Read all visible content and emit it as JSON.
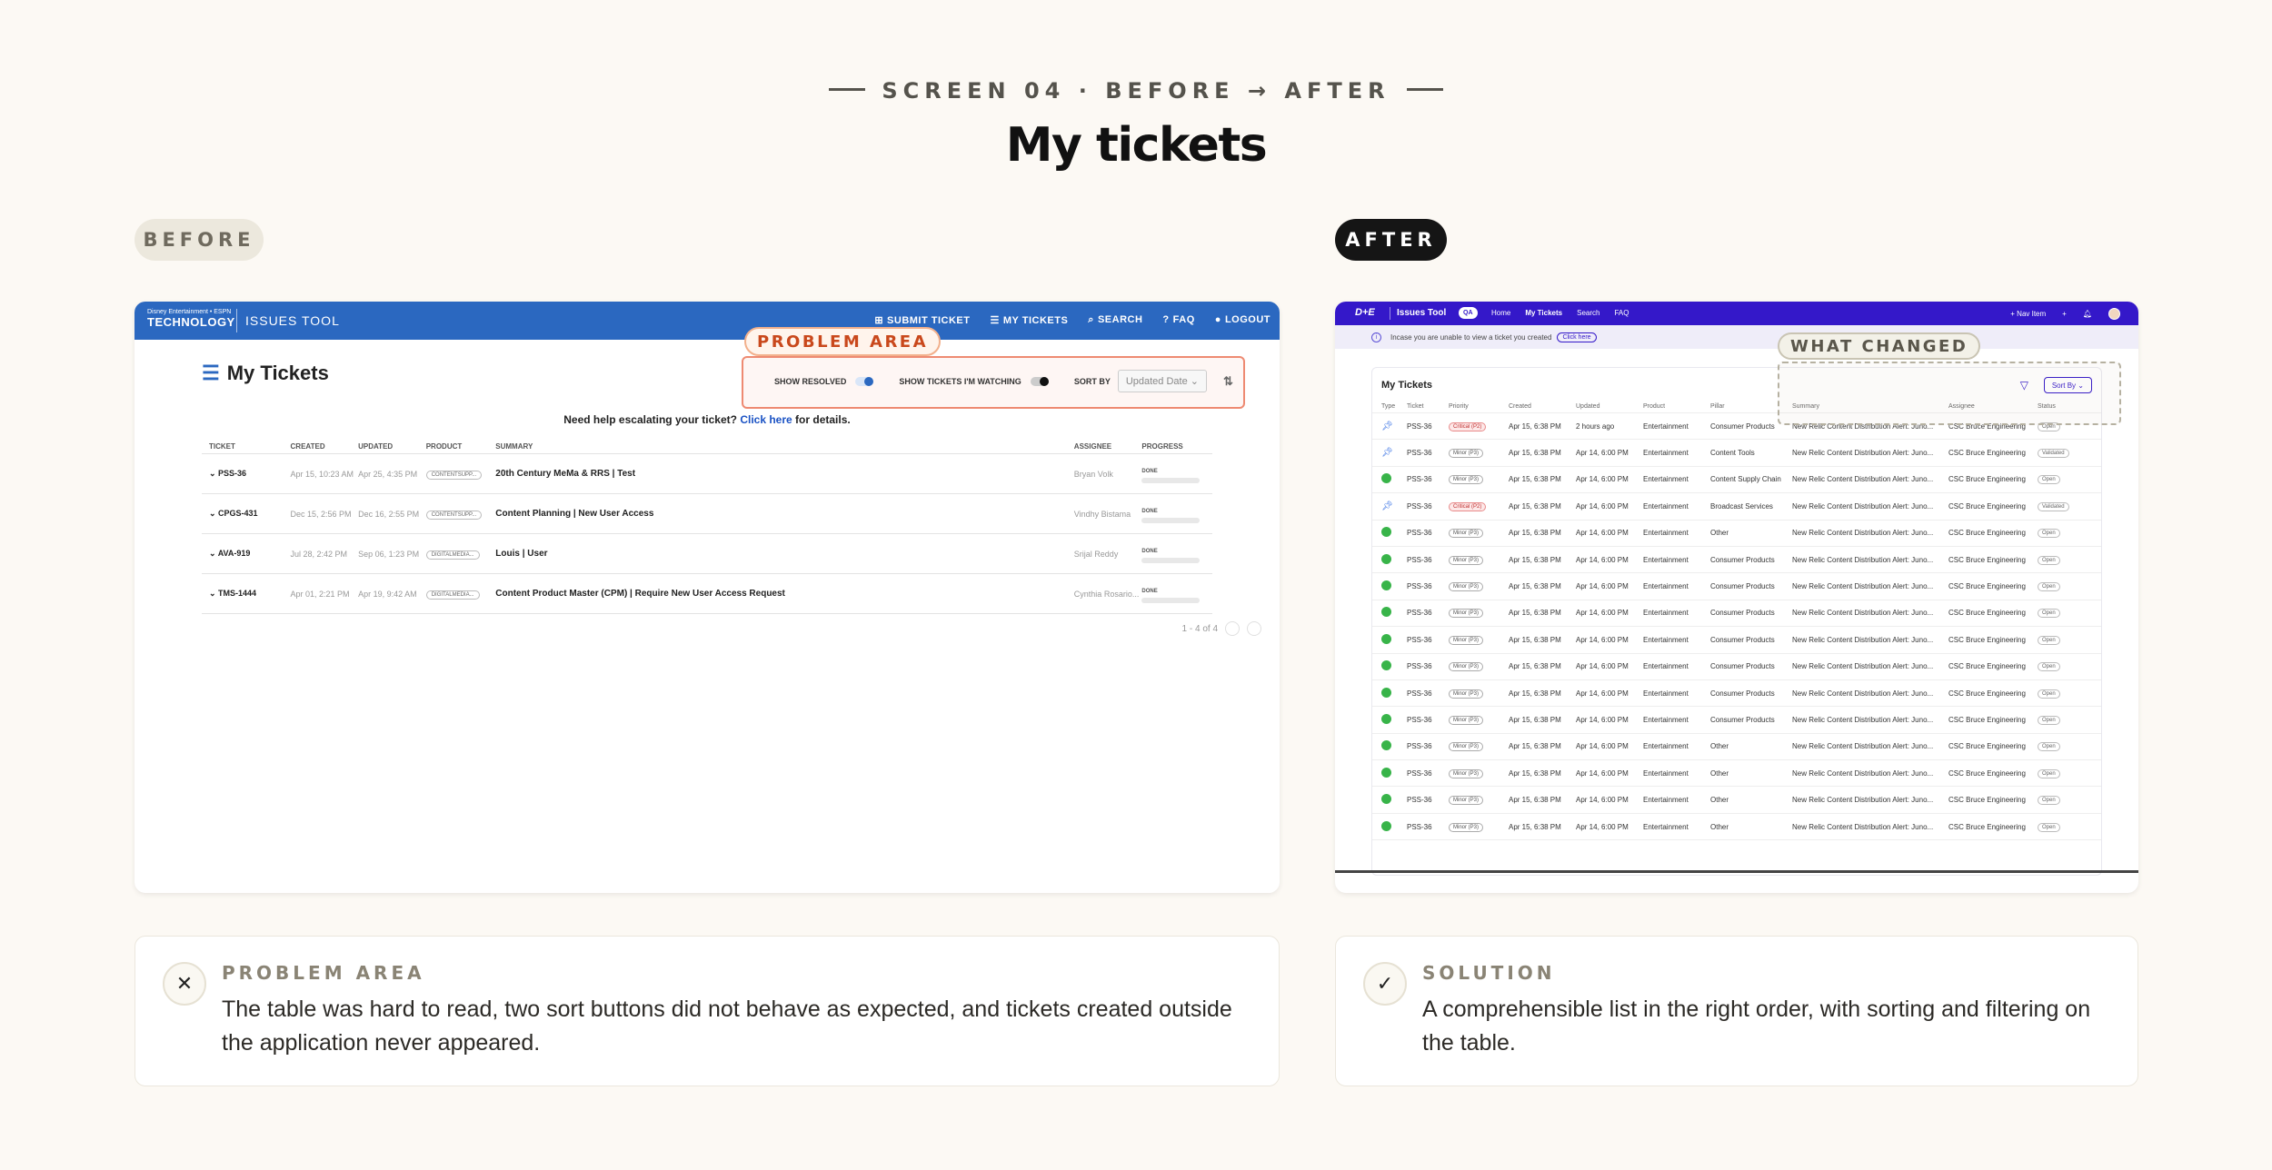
{
  "eyebrow": "SCREEN 04 · BEFORE → AFTER",
  "headline": "My tickets",
  "before_label": "BEFORE",
  "after_label": "AFTER",
  "before_screen": {
    "brand_line1": "Disney Entertainment • ESPN",
    "brand_line2": "TECHNOLOGY",
    "app_name": "ISSUES TOOL",
    "nav": [
      "SUBMIT TICKET",
      "MY TICKETS",
      "SEARCH",
      "FAQ",
      "LOGOUT"
    ],
    "title": "My Tickets",
    "problem_label": "PROBLEM AREA",
    "show_resolved": "SHOW RESOLVED",
    "show_watching": "SHOW TICKETS I'M WATCHING",
    "sort_by": "SORT BY",
    "sort_value": "Updated Date",
    "help_prefix": "Need help escalating your ticket?",
    "help_link": "Click here",
    "help_suffix": "for details.",
    "columns": [
      "TICKET",
      "CREATED",
      "UPDATED",
      "PRODUCT",
      "SUMMARY",
      "ASSIGNEE",
      "PROGRESS"
    ],
    "rows": [
      {
        "ticket": "PSS-36",
        "created": "Apr 15, 10:23 AM",
        "updated": "Apr 25, 4:35 PM",
        "product": "CONTENTSUPP...",
        "summary": "20th Century MeMa & RRS | Test",
        "assignee": "Bryan Volk",
        "progress": "DONE"
      },
      {
        "ticket": "CPGS-431",
        "created": "Dec 15, 2:56 PM",
        "updated": "Dec 16, 2:55 PM",
        "product": "CONTENTSUPP...",
        "summary": "Content Planning | New User Access",
        "assignee": "Vindhy Bistama",
        "progress": "DONE"
      },
      {
        "ticket": "AVA-919",
        "created": "Jul 28, 2:42 PM",
        "updated": "Sep 06, 1:23 PM",
        "product": "DIGITALMEDIA...",
        "summary": "Louis | User",
        "assignee": "Srijal Reddy",
        "progress": "DONE"
      },
      {
        "ticket": "TMS-1444",
        "created": "Apr 01, 2:21 PM",
        "updated": "Apr 19, 9:42 AM",
        "product": "DIGITALMEDIA...",
        "summary": "Content Product Master (CPM) | Require New User Access Request",
        "assignee": "Cynthia Rosario...",
        "progress": "DONE"
      }
    ],
    "pager": "1 - 4 of 4"
  },
  "after_screen": {
    "brand": "D+E",
    "app_name": "Issues Tool",
    "env_badge": "QA",
    "nav": [
      "Home",
      "My Tickets",
      "Search",
      "FAQ"
    ],
    "new_item": "+ Nav Item",
    "banner_text": "Incase you are unable to view a ticket you created",
    "banner_button": "Click here",
    "what_changed_label": "WHAT CHANGED",
    "card_title": "My Tickets",
    "sort_button": "Sort By",
    "columns": [
      "Type",
      "Ticket",
      "Priority",
      "Created",
      "Updated",
      "Product",
      "Pillar",
      "Summary",
      "Assignee",
      "Status"
    ],
    "rows": [
      {
        "type": "pin",
        "ticket": "PSS-36",
        "priority": "Critical (P2)",
        "created": "Apr 15, 6:38 PM",
        "updated": "2 hours ago",
        "product": "Entertainment",
        "pillar": "Consumer Products",
        "summary": "New Relic Content Distribution Alert: Juno...",
        "assignee": "CSC Bruce Engineering",
        "status": "Open"
      },
      {
        "type": "pin",
        "ticket": "PSS-36",
        "priority": "Minor (P3)",
        "created": "Apr 15, 6:38 PM",
        "updated": "Apr 14, 6:00 PM",
        "product": "Entertainment",
        "pillar": "Content Tools",
        "summary": "New Relic Content Distribution Alert: Juno...",
        "assignee": "CSC Bruce Engineering",
        "status": "Validated"
      },
      {
        "type": "bug",
        "ticket": "PSS-36",
        "priority": "Minor (P3)",
        "created": "Apr 15, 6:38 PM",
        "updated": "Apr 14, 6:00 PM",
        "product": "Entertainment",
        "pillar": "Content Supply Chain",
        "summary": "New Relic Content Distribution Alert: Juno...",
        "assignee": "CSC Bruce Engineering",
        "status": "Open"
      },
      {
        "type": "pin",
        "ticket": "PSS-36",
        "priority": "Critical (P2)",
        "created": "Apr 15, 6:38 PM",
        "updated": "Apr 14, 6:00 PM",
        "product": "Entertainment",
        "pillar": "Broadcast Services",
        "summary": "New Relic Content Distribution Alert: Juno...",
        "assignee": "CSC Bruce Engineering",
        "status": "Validated"
      },
      {
        "type": "bug",
        "ticket": "PSS-36",
        "priority": "Minor (P3)",
        "created": "Apr 15, 6:38 PM",
        "updated": "Apr 14, 6:00 PM",
        "product": "Entertainment",
        "pillar": "Other",
        "summary": "New Relic Content Distribution Alert: Juno...",
        "assignee": "CSC Bruce Engineering",
        "status": "Open"
      },
      {
        "type": "bug",
        "ticket": "PSS-36",
        "priority": "Minor (P3)",
        "created": "Apr 15, 6:38 PM",
        "updated": "Apr 14, 6:00 PM",
        "product": "Entertainment",
        "pillar": "Consumer Products",
        "summary": "New Relic Content Distribution Alert: Juno...",
        "assignee": "CSC Bruce Engineering",
        "status": "Open"
      },
      {
        "type": "bug",
        "ticket": "PSS-36",
        "priority": "Minor (P3)",
        "created": "Apr 15, 6:38 PM",
        "updated": "Apr 14, 6:00 PM",
        "product": "Entertainment",
        "pillar": "Consumer Products",
        "summary": "New Relic Content Distribution Alert: Juno...",
        "assignee": "CSC Bruce Engineering",
        "status": "Open"
      },
      {
        "type": "bug",
        "ticket": "PSS-36",
        "priority": "Minor (P3)",
        "created": "Apr 15, 6:38 PM",
        "updated": "Apr 14, 6:00 PM",
        "product": "Entertainment",
        "pillar": "Consumer Products",
        "summary": "New Relic Content Distribution Alert: Juno...",
        "assignee": "CSC Bruce Engineering",
        "status": "Open"
      },
      {
        "type": "bug",
        "ticket": "PSS-36",
        "priority": "Minor (P3)",
        "created": "Apr 15, 6:38 PM",
        "updated": "Apr 14, 6:00 PM",
        "product": "Entertainment",
        "pillar": "Consumer Products",
        "summary": "New Relic Content Distribution Alert: Juno...",
        "assignee": "CSC Bruce Engineering",
        "status": "Open"
      },
      {
        "type": "bug",
        "ticket": "PSS-36",
        "priority": "Minor (P3)",
        "created": "Apr 15, 6:38 PM",
        "updated": "Apr 14, 6:00 PM",
        "product": "Entertainment",
        "pillar": "Consumer Products",
        "summary": "New Relic Content Distribution Alert: Juno...",
        "assignee": "CSC Bruce Engineering",
        "status": "Open"
      },
      {
        "type": "bug",
        "ticket": "PSS-36",
        "priority": "Minor (P3)",
        "created": "Apr 15, 6:38 PM",
        "updated": "Apr 14, 6:00 PM",
        "product": "Entertainment",
        "pillar": "Consumer Products",
        "summary": "New Relic Content Distribution Alert: Juno...",
        "assignee": "CSC Bruce Engineering",
        "status": "Open"
      },
      {
        "type": "bug",
        "ticket": "PSS-36",
        "priority": "Minor (P3)",
        "created": "Apr 15, 6:38 PM",
        "updated": "Apr 14, 6:00 PM",
        "product": "Entertainment",
        "pillar": "Consumer Products",
        "summary": "New Relic Content Distribution Alert: Juno...",
        "assignee": "CSC Bruce Engineering",
        "status": "Open"
      },
      {
        "type": "bug",
        "ticket": "PSS-36",
        "priority": "Minor (P3)",
        "created": "Apr 15, 6:38 PM",
        "updated": "Apr 14, 6:00 PM",
        "product": "Entertainment",
        "pillar": "Other",
        "summary": "New Relic Content Distribution Alert: Juno...",
        "assignee": "CSC Bruce Engineering",
        "status": "Open"
      },
      {
        "type": "bug",
        "ticket": "PSS-36",
        "priority": "Minor (P3)",
        "created": "Apr 15, 6:38 PM",
        "updated": "Apr 14, 6:00 PM",
        "product": "Entertainment",
        "pillar": "Other",
        "summary": "New Relic Content Distribution Alert: Juno...",
        "assignee": "CSC Bruce Engineering",
        "status": "Open"
      },
      {
        "type": "bug",
        "ticket": "PSS-36",
        "priority": "Minor (P3)",
        "created": "Apr 15, 6:38 PM",
        "updated": "Apr 14, 6:00 PM",
        "product": "Entertainment",
        "pillar": "Other",
        "summary": "New Relic Content Distribution Alert: Juno...",
        "assignee": "CSC Bruce Engineering",
        "status": "Open"
      },
      {
        "type": "bug",
        "ticket": "PSS-36",
        "priority": "Minor (P3)",
        "created": "Apr 15, 6:38 PM",
        "updated": "Apr 14, 6:00 PM",
        "product": "Entertainment",
        "pillar": "Other",
        "summary": "New Relic Content Distribution Alert: Juno...",
        "assignee": "CSC Bruce Engineering",
        "status": "Open"
      }
    ]
  },
  "problem_card": {
    "label": "PROBLEM AREA",
    "text": "The table was hard to read, two sort buttons did not behave as expected, and tickets created outside the application never appeared."
  },
  "solution_card": {
    "label": "SOLUTION",
    "text": "A comprehensible list in the right order, with sorting and filtering on the table."
  },
  "icons": {
    "problem": "close-icon",
    "solution": "check-icon"
  },
  "colors": {
    "before_nav": "#2b68c0",
    "after_nav": "#3418c9",
    "problem_accent": "#c9481c",
    "background": "#fcf9f4"
  }
}
